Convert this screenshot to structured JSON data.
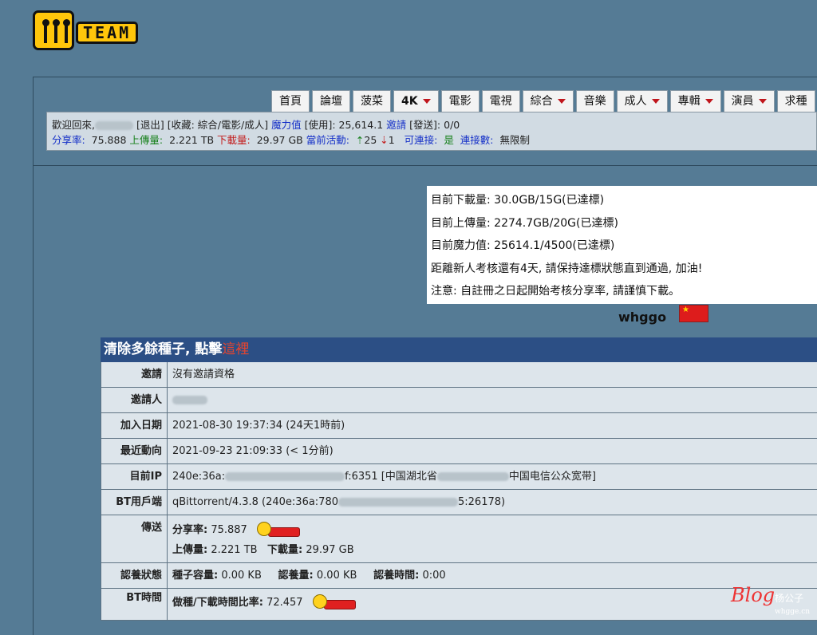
{
  "logo": {
    "text": "TEAM"
  },
  "nav": {
    "tabs": [
      {
        "label": "首頁",
        "dropdown": false
      },
      {
        "label": "論壇",
        "dropdown": false
      },
      {
        "label": "菠菜",
        "dropdown": false
      },
      {
        "label": "4K",
        "dropdown": true,
        "bold": true
      },
      {
        "label": "電影",
        "dropdown": false
      },
      {
        "label": "電視",
        "dropdown": false
      },
      {
        "label": "綜合",
        "dropdown": true
      },
      {
        "label": "音樂",
        "dropdown": false
      },
      {
        "label": "成人",
        "dropdown": true
      },
      {
        "label": "專輯",
        "dropdown": true
      },
      {
        "label": "演員",
        "dropdown": true
      },
      {
        "label": "求種",
        "dropdown": false
      }
    ]
  },
  "infobar": {
    "welcome": "歡迎回來,",
    "logout": "[退出]",
    "favorites": "[收藏: 綜合/電影/成人]",
    "magic_label": "魔力值",
    "magic_value": "[使用]: 25,614.1",
    "invite_label": "邀請",
    "invite_value": "[發送]: 0/0",
    "ratio_label": "分享率:",
    "ratio_value": "75.888",
    "upload_label": "上傳量:",
    "upload_value": "2.221 TB",
    "download_label": "下載量:",
    "download_value": "29.97 GB",
    "active_label": "當前活動:",
    "active_up": "25",
    "active_down": "1",
    "connectable_label": "可連接:",
    "connectable_value": "是",
    "connections_label": "連接數:",
    "connections_value": "無限制"
  },
  "notice": {
    "lines": [
      "目前下載量: 30.0GB/15G(已達標)",
      "目前上傳量: 2274.7GB/20G(已達標)",
      "目前魔力值: 25614.1/4500(已達標)",
      "距離新人考核還有4天, 請保持達標狀態直到通過, 加油!",
      "注意: 自註冊之日起開始考核分享率, 請謹慎下載。"
    ]
  },
  "profile": {
    "username": "whggo"
  },
  "details": {
    "header_text": "清除多餘種子, 點擊",
    "header_link": "這裡",
    "rows": {
      "invite": {
        "label": "邀請",
        "value": "沒有邀請資格"
      },
      "inviter": {
        "label": "邀請人"
      },
      "joined": {
        "label": "加入日期",
        "value": "2021-08-30 19:37:34 (24天1時前)"
      },
      "last_seen": {
        "label": "最近動向",
        "value": "2021-09-23 21:09:33 (< 1分前)"
      },
      "ip": {
        "label": "目前IP",
        "prefix": "240e:36a:",
        "mid": "f:6351 [中国湖北省",
        "suffix": "中国电信公众宽带]"
      },
      "client": {
        "label": "BT用戶端",
        "prefix": "qBittorrent/4.3.8 (240e:36a:780",
        "suffix": "5:26178)"
      },
      "transfer": {
        "label": "傳送",
        "ratio_label": "分享率:",
        "ratio_value": "75.887",
        "up_label": "上傳量:",
        "up_value": "2.221 TB",
        "down_label": "下載量:",
        "down_value": "29.97 GB"
      },
      "seeding": {
        "label": "認養狀態",
        "size_label": "種子容量:",
        "size_value": "0.00 KB",
        "adopt_label": "認養量:",
        "adopt_value": "0.00 KB",
        "time_label": "認養時間:",
        "time_value": "0:00"
      },
      "bt_time": {
        "label": "BT時間",
        "ratio_label": "做種/下載時間比率:",
        "ratio_value": "72.457"
      }
    }
  },
  "watermark": {
    "blog": "Blog",
    "name": "杨公子",
    "domain": "whgge.cn"
  }
}
